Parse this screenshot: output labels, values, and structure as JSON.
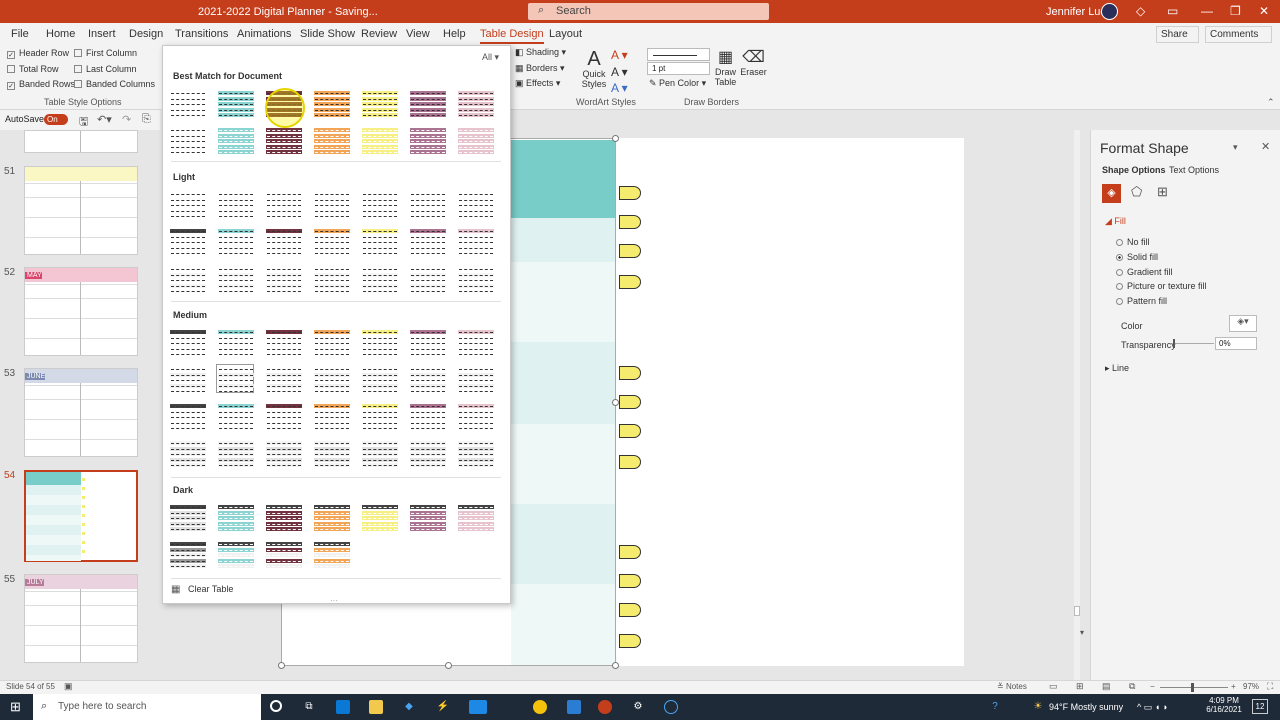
{
  "app": {
    "title": "2021-2022 Digital Planner  -  Saving...",
    "search_placeholder": "Search",
    "user_name": "Jennifer Lucas"
  },
  "tabs": [
    "File",
    "Home",
    "Insert",
    "Design",
    "Transitions",
    "Animations",
    "Slide Show",
    "Review",
    "View",
    "Help",
    "Table Design",
    "Layout"
  ],
  "active_tab": "Table Design",
  "share_label": "Share",
  "comments_label": "Comments",
  "table_style_options": {
    "header_row": "Header Row",
    "first_column": "First Column",
    "total_row": "Total Row",
    "last_column": "Last Column",
    "banded_rows": "Banded Rows",
    "banded_columns": "Banded Columns",
    "group_label": "Table Style Options"
  },
  "ribbon": {
    "all_label": "All",
    "shading": "Shading",
    "borders": "Borders",
    "effects": "Effects",
    "quick_styles": "Quick Styles",
    "wordart_label": "WordArt Styles",
    "pen_weight": "1 pt",
    "pen_color": "Pen Color",
    "draw_table": "Draw Table",
    "eraser": "Eraser",
    "draw_borders_label": "Draw Borders"
  },
  "qat": {
    "autosave": "AutoSave",
    "toggle": "On"
  },
  "gallery": {
    "best_match": "Best Match for Document",
    "light": "Light",
    "medium": "Medium",
    "dark": "Dark",
    "clear_table": "Clear Table"
  },
  "slides": [
    {
      "num": "51",
      "month": ""
    },
    {
      "num": "52",
      "month": "MAY"
    },
    {
      "num": "53",
      "month": "JUNE"
    },
    {
      "num": "54",
      "month": ""
    },
    {
      "num": "55",
      "month": "JULY"
    }
  ],
  "format_pane": {
    "title": "Format Shape",
    "shape_options": "Shape Options",
    "text_options": "Text Options",
    "fill": "Fill",
    "no_fill": "No fill",
    "solid_fill": "Solid fill",
    "gradient_fill": "Gradient fill",
    "picture_fill": "Picture or texture fill",
    "pattern_fill": "Pattern fill",
    "color": "Color",
    "transparency": "Transparency",
    "transparency_value": "0%",
    "line": "Line"
  },
  "status": {
    "slide_info": "Slide 54 of 55",
    "notes": "Notes",
    "zoom": "97%"
  },
  "taskbar": {
    "search": "Type here to search",
    "weather": "94°F  Mostly sunny",
    "time": "4:09 PM",
    "date": "6/16/2021",
    "notif": "12"
  },
  "colors": {
    "accent": "#c43e1c",
    "teal": "#78cdc9",
    "teal_light": "#dff1f0",
    "yellow": "#f5ec6f",
    "maroon": "#5a0e1e",
    "orange": "#f0943a",
    "plum": "#9c5a7e",
    "pink": "#e3b8c4",
    "gray": "#888888"
  }
}
